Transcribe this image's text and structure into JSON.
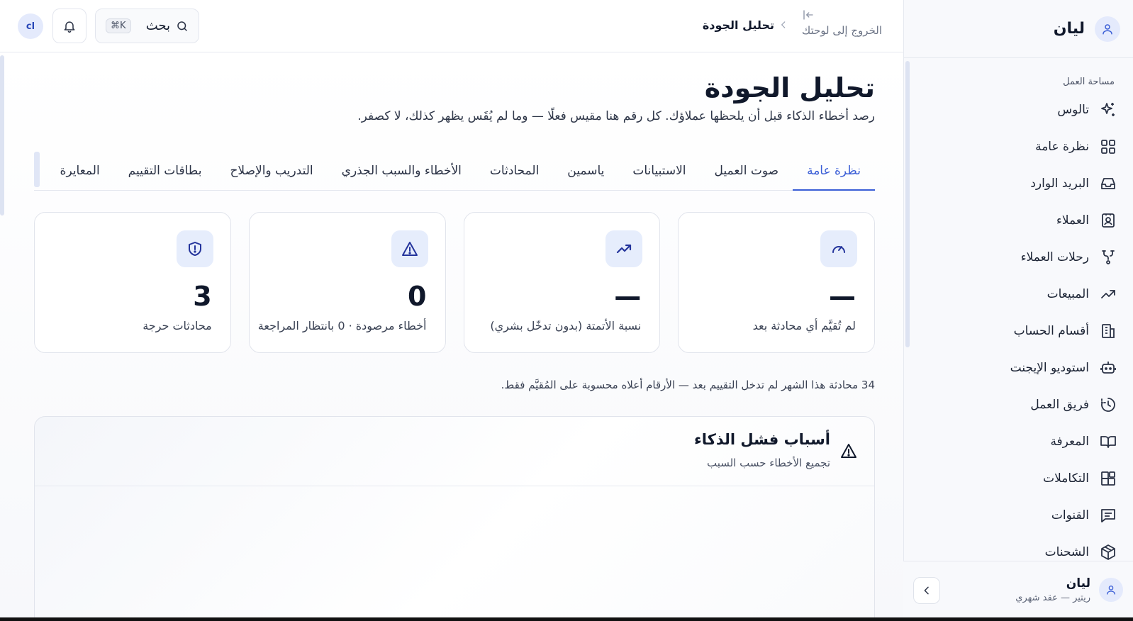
{
  "sidebar": {
    "user_name": "ليان",
    "section_label": "مساحة العمل",
    "items": [
      {
        "label": "تالوس",
        "icon": "sparkles-icon"
      },
      {
        "label": "نظرة عامة",
        "icon": "grid-icon"
      },
      {
        "label": "البريد الوارد",
        "icon": "inbox-icon"
      },
      {
        "label": "العملاء",
        "icon": "contact-card-icon"
      },
      {
        "label": "رحلات العملاء",
        "icon": "route-icon"
      },
      {
        "label": "المبيعات",
        "icon": "trend-up-icon"
      },
      {
        "label": "أقسام الحساب",
        "icon": "building-icon"
      },
      {
        "label": "استوديو الإيجنت",
        "icon": "bot-icon"
      },
      {
        "label": "فريق العمل",
        "icon": "history-clock-icon"
      },
      {
        "label": "المعرفة",
        "icon": "book-icon"
      },
      {
        "label": "التكاملات",
        "icon": "blocks-icon"
      },
      {
        "label": "القنوات",
        "icon": "message-square-icon"
      },
      {
        "label": "الشحنات",
        "icon": "package-icon"
      }
    ],
    "footer": {
      "name": "ليان",
      "subtitle": "ريتير — عقد شهري"
    }
  },
  "topbar": {
    "back_label": "الخروج إلى لوحتك",
    "breadcrumb_current": "تحليل الجودة",
    "search_label": "بحث",
    "search_shortcut": "⌘K",
    "user_initials": "cl"
  },
  "page": {
    "title": "تحليل الجودة",
    "subtitle": "رصد أخطاء الذكاء قبل أن يلحظها عملاؤك. كل رقم هنا مقيس فعلًا — وما لم يُقَس يظهر كذلك، لا كصفر."
  },
  "tabs": [
    {
      "label": "نظرة عامة",
      "active": true
    },
    {
      "label": "صوت العميل",
      "active": false
    },
    {
      "label": "الاستبيانات",
      "active": false
    },
    {
      "label": "ياسمين",
      "active": false
    },
    {
      "label": "المحادثات",
      "active": false
    },
    {
      "label": "الأخطاء والسبب الجذري",
      "active": false
    },
    {
      "label": "التدريب والإصلاح",
      "active": false
    },
    {
      "label": "بطاقات التقييم",
      "active": false
    },
    {
      "label": "المعايرة",
      "active": false
    }
  ],
  "cards": [
    {
      "value": "—",
      "label": "لم تُقيَّم أي محادثة بعد",
      "icon": "gauge-icon"
    },
    {
      "value": "—",
      "label": "نسبة الأتمتة (بدون تدخّل بشري)",
      "icon": "trend-up-icon"
    },
    {
      "value": "0",
      "label": "أخطاء مرصودة · 0 بانتظار المراجعة",
      "icon": "warning-triangle-icon"
    },
    {
      "value": "3",
      "label": "محادثات حرجة",
      "icon": "shield-alert-icon"
    }
  ],
  "note": "34 محادثة هذا الشهر لم تدخل التقييم بعد — الأرقام أعلاه محسوبة على المُقيَّم فقط.",
  "panel": {
    "title": "أسباب فشل الذكاء",
    "subtitle": "تجميع الأخطاء حسب السبب",
    "icon": "warning-triangle-icon"
  },
  "colors": {
    "accent": "#3a5ed6",
    "icon_bg": "#e6edfc",
    "text_primary": "#10182b"
  }
}
